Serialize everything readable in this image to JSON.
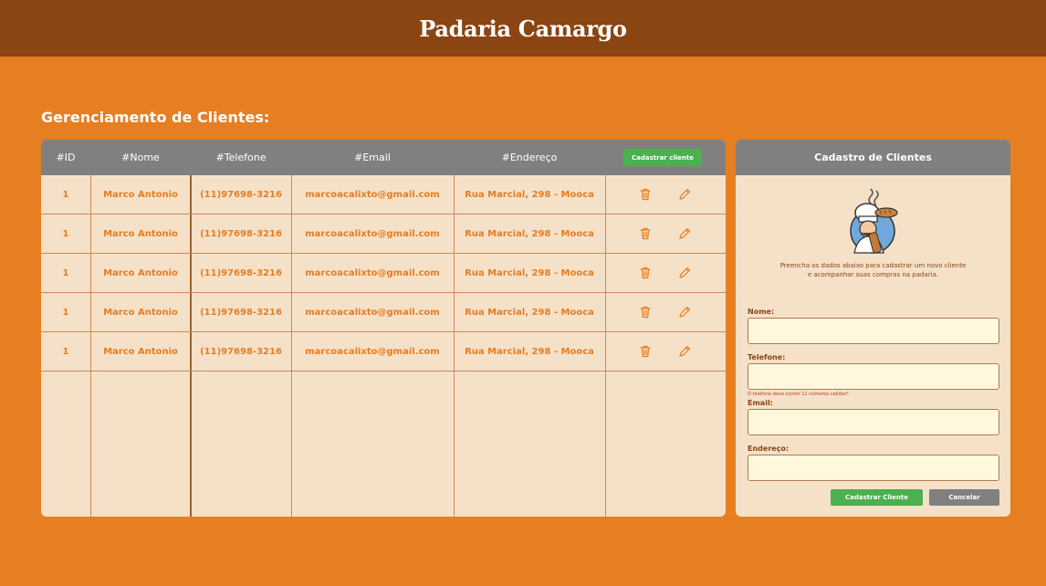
{
  "app": {
    "title": "Padaria Camargo"
  },
  "page": {
    "section_title": "Gerenciamento de Clientes:"
  },
  "table": {
    "headers": {
      "id": "#ID",
      "name": "#Nome",
      "phone": "#Telefone",
      "email": "#Email",
      "address": "#Endereço"
    },
    "add_button": "Cadastrar cliente",
    "rows": [
      {
        "id": "1",
        "name": "Marco Antonio",
        "phone": "(11)97698-3216",
        "email": "marcoacalixto@gmail.com",
        "address": "Rua Marcial, 298 - Mooca"
      },
      {
        "id": "1",
        "name": "Marco Antonio",
        "phone": "(11)97698-3216",
        "email": "marcoacalixto@gmail.com",
        "address": "Rua Marcial, 298 - Mooca"
      },
      {
        "id": "1",
        "name": "Marco Antonio",
        "phone": "(11)97698-3216",
        "email": "marcoacalixto@gmail.com",
        "address": "Rua Marcial, 298 - Mooca"
      },
      {
        "id": "1",
        "name": "Marco Antonio",
        "phone": "(11)97698-3216",
        "email": "marcoacalixto@gmail.com",
        "address": "Rua Marcial, 298 - Mooca"
      },
      {
        "id": "1",
        "name": "Marco Antonio",
        "phone": "(11)97698-3216",
        "email": "marcoacalixto@gmail.com",
        "address": "Rua Marcial, 298 - Mooca"
      }
    ],
    "row_action_icons": [
      "trash-icon",
      "pencil-icon"
    ]
  },
  "form": {
    "title": "Cadastro de Clientes",
    "intro_line1": "Preencha os dados abaixo para cadastrar um novo cliente",
    "intro_line2": "e acompanhar suas compras na padaria.",
    "fields": {
      "name_label": "Nome:",
      "phone_label": "Telefone:",
      "phone_hint": "O telefone deve conter 11 números validos*",
      "email_label": "Email:",
      "address_label": "Endereço:"
    },
    "submit_button": "Cadastrar Cliente",
    "cancel_button": "Cancelar"
  },
  "colors": {
    "page_bg": "#E67E22",
    "topbar_bg": "#8B4513",
    "panel_bg": "#F5E1C8",
    "header_bg": "#808080",
    "primary_button": "#4CAF50",
    "cell_text": "#E67E22",
    "input_bg": "#FFF8DC"
  }
}
